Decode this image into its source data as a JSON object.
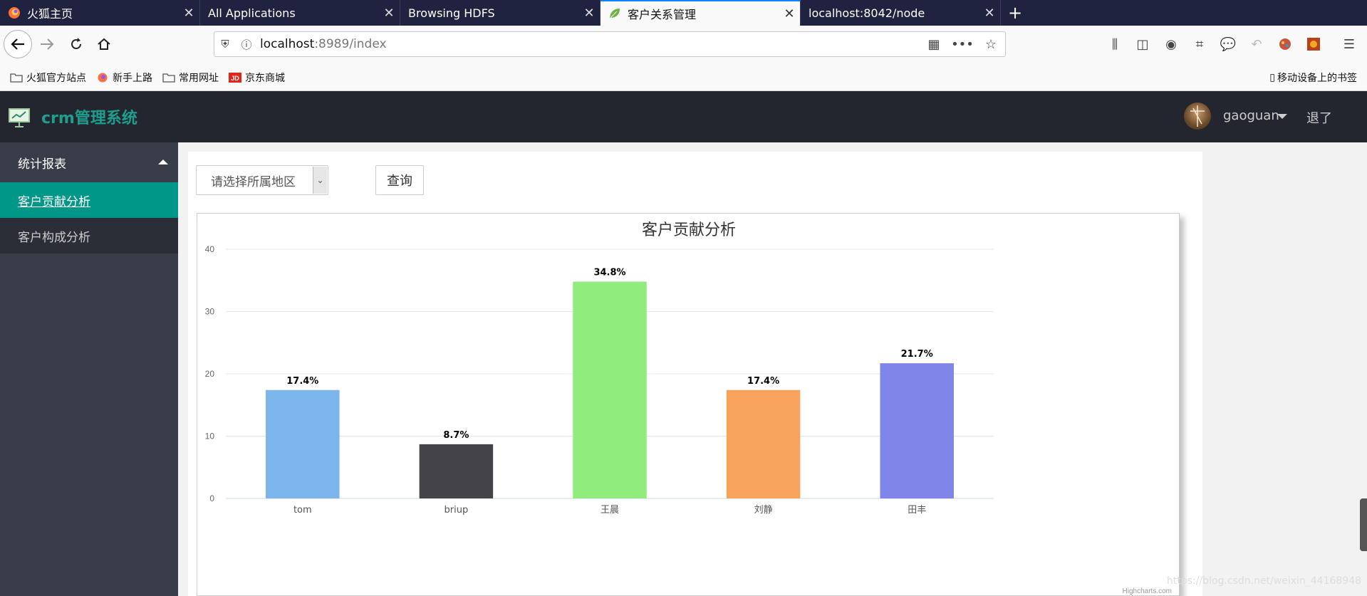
{
  "browser": {
    "tabs": [
      {
        "title": "火狐主页",
        "icon": "firefox-icon",
        "active": false
      },
      {
        "title": "All Applications",
        "icon": "",
        "active": false
      },
      {
        "title": "Browsing HDFS",
        "icon": "",
        "active": false
      },
      {
        "title": "客户关系管理",
        "icon": "leaf-icon",
        "active": true
      },
      {
        "title": "localhost:8042/node",
        "icon": "",
        "active": false
      }
    ],
    "close_glyph": "✕",
    "new_tab_glyph": "+",
    "url_host": "localhost",
    "url_port": ":8989",
    "url_path": "/index",
    "bookmarks": [
      {
        "label": "火狐官方站点",
        "icon": "folder-icon"
      },
      {
        "label": "新手上路",
        "icon": "firefox-icon"
      },
      {
        "label": "常用网址",
        "icon": "folder-icon"
      },
      {
        "label": "京东商城",
        "icon": "jd-icon"
      }
    ],
    "mobile_bookmarks": "移动设备上的书签"
  },
  "app": {
    "name": "crm管理系统",
    "user": "gaoguan",
    "logout": "退了"
  },
  "sidebar": {
    "group": "统计报表",
    "items": [
      {
        "label": "客户贡献分析",
        "active": true
      },
      {
        "label": "客户构成分析",
        "active": false
      }
    ]
  },
  "filters": {
    "region_placeholder": "请选择所属地区",
    "query_button": "查询"
  },
  "chart_data": {
    "type": "bar",
    "title": "客户贡献分析",
    "categories": [
      "tom",
      "briup",
      "王晨",
      "刘静",
      "田丰"
    ],
    "values": [
      17.4,
      8.7,
      34.8,
      17.4,
      21.7
    ],
    "data_labels": [
      "17.4%",
      "8.7%",
      "34.8%",
      "17.4%",
      "21.7%"
    ],
    "colors": [
      "#7cb5ec",
      "#434348",
      "#90ed7d",
      "#f7a35c",
      "#8085e9"
    ],
    "ylim": [
      0,
      40
    ],
    "yticks": [
      0,
      10,
      20,
      30,
      40
    ],
    "grid": true,
    "credits": "Highcharts.com"
  },
  "watermark": "https://blog.csdn.net/weixin_44168948"
}
